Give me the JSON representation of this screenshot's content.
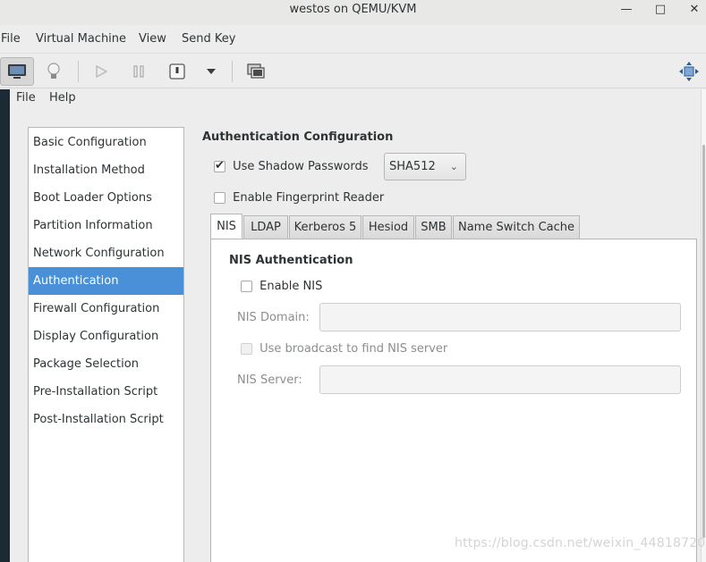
{
  "window": {
    "title": "westos on QEMU/KVM",
    "minimize_glyph": "—",
    "maximize_glyph": "□",
    "close_glyph": "✕"
  },
  "menubar": {
    "items": [
      "File",
      "Virtual Machine",
      "View",
      "Send Key"
    ]
  },
  "toolbar": {
    "icons": [
      "console-icon",
      "lightbulb-icon",
      "play-icon",
      "pause-icon",
      "power-icon",
      "dropdown-arrow-icon",
      "snapshot-icon",
      "fullscreen-icon"
    ]
  },
  "app": {
    "menubar": {
      "items": [
        "File",
        "Help"
      ]
    },
    "sidebar": {
      "items": [
        "Basic Configuration",
        "Installation Method",
        "Boot Loader Options",
        "Partition Information",
        "Network Configuration",
        "Authentication",
        "Firewall Configuration",
        "Display Configuration",
        "Package Selection",
        "Pre-Installation Script",
        "Post-Installation Script"
      ],
      "selected": "Authentication"
    },
    "auth": {
      "section_title": "Authentication Configuration",
      "shadow_label": "Use Shadow Passwords",
      "shadow_checked": true,
      "hash_value": "SHA512",
      "fingerprint_label": "Enable Fingerprint Reader",
      "fingerprint_checked": false
    },
    "tabs": {
      "items": [
        "NIS",
        "LDAP",
        "Kerberos 5",
        "Hesiod",
        "SMB",
        "Name Switch Cache"
      ],
      "active": "NIS"
    },
    "nis": {
      "heading": "NIS Authentication",
      "enable_label": "Enable NIS",
      "enable_checked": false,
      "domain_label": "NIS Domain:",
      "domain_value": "",
      "broadcast_label": "Use broadcast to find NIS server",
      "server_label": "NIS Server:",
      "server_value": ""
    }
  },
  "watermark": "https://blog.csdn.net/weixin_44818720",
  "colors": {
    "selection": "#4a90d9",
    "window_bg": "#ededed",
    "guest_edge": "#1b2a33"
  }
}
